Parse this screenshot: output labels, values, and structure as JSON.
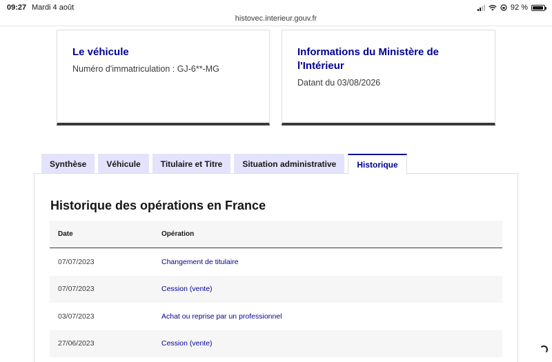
{
  "status_bar": {
    "time": "09:27",
    "date": "Mardi 4 août",
    "battery": "92 %",
    "battery_level": 0.92
  },
  "browser": {
    "url": "histovec.interieur.gouv.fr"
  },
  "cards": {
    "vehicle": {
      "title": "Le véhicule",
      "text": "Numéro d'immatriculation : GJ-6**-MG"
    },
    "ministry": {
      "title": "Informations du Ministère de l'Intérieur",
      "text": "Datant du 03/08/2026"
    }
  },
  "tabs": [
    {
      "label": "Synthèse",
      "active": false
    },
    {
      "label": "Véhicule",
      "active": false
    },
    {
      "label": "Titulaire et Titre",
      "active": false
    },
    {
      "label": "Situation administrative",
      "active": false
    },
    {
      "label": "Historique",
      "active": true
    }
  ],
  "history": {
    "title": "Historique des opérations en France",
    "headers": {
      "date": "Date",
      "operation": "Opération"
    },
    "rows": [
      {
        "date": "07/07/2023",
        "operation": "Changement de titulaire"
      },
      {
        "date": "07/07/2023",
        "operation": "Cession (vente)"
      },
      {
        "date": "03/07/2023",
        "operation": "Achat ou reprise par un professionnel"
      },
      {
        "date": "27/06/2023",
        "operation": "Cession (vente)"
      }
    ]
  },
  "colors": {
    "accent": "#000091",
    "tab_background": "#e3e3fd",
    "row_alt": "#f6f6f6"
  }
}
